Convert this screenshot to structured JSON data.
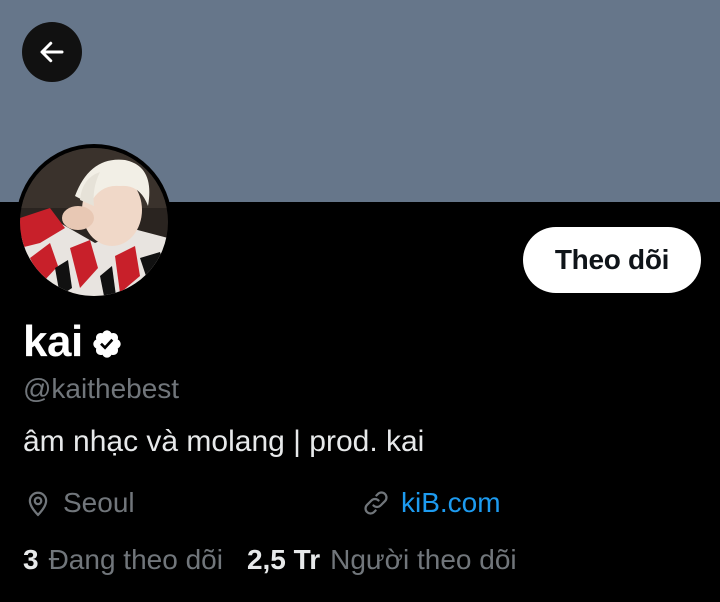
{
  "banner": {
    "color": "#66768a"
  },
  "back_icon": "arrow-left-icon",
  "profile": {
    "name": "kai",
    "handle": "@kaithebest",
    "bio": "âm nhạc và molang | prod. kai",
    "location": "Seoul",
    "website": "kiB.com",
    "verified_icon": "verified-badge-icon"
  },
  "actions": {
    "follow_label": "Theo dõi"
  },
  "stats": {
    "following_count": "3",
    "following_label": "Đang theo dõi",
    "followers_count": "2,5 Tr",
    "followers_label": "Người theo dõi"
  },
  "colors": {
    "background": "#000000",
    "muted_text": "#71767b",
    "link": "#1d9bf0",
    "button_bg": "#ffffff"
  }
}
